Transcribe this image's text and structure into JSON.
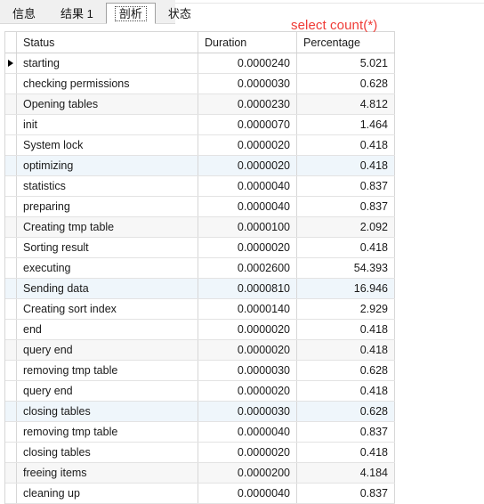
{
  "tabbar": {
    "tabs": [
      {
        "label": "信息",
        "active": false
      },
      {
        "label": "结果 1",
        "active": false
      },
      {
        "label": "剖析",
        "active": true
      },
      {
        "label": "状态",
        "active": false
      }
    ]
  },
  "annotation": {
    "text": "select count(*)",
    "color": "#ef3b36"
  },
  "grid": {
    "columns": [
      "Status",
      "Duration",
      "Percentage"
    ],
    "current_row_index": 0,
    "rows": [
      {
        "status": "starting",
        "duration": "0.0000240",
        "percentage": "5.021",
        "bg": "none"
      },
      {
        "status": "checking permissions",
        "duration": "0.0000030",
        "percentage": "0.628",
        "bg": "none"
      },
      {
        "status": "Opening tables",
        "duration": "0.0000230",
        "percentage": "4.812",
        "bg": "gray"
      },
      {
        "status": "init",
        "duration": "0.0000070",
        "percentage": "1.464",
        "bg": "none"
      },
      {
        "status": "System lock",
        "duration": "0.0000020",
        "percentage": "0.418",
        "bg": "none"
      },
      {
        "status": "optimizing",
        "duration": "0.0000020",
        "percentage": "0.418",
        "bg": "blue"
      },
      {
        "status": "statistics",
        "duration": "0.0000040",
        "percentage": "0.837",
        "bg": "none"
      },
      {
        "status": "preparing",
        "duration": "0.0000040",
        "percentage": "0.837",
        "bg": "none"
      },
      {
        "status": "Creating tmp table",
        "duration": "0.0000100",
        "percentage": "2.092",
        "bg": "gray"
      },
      {
        "status": "Sorting result",
        "duration": "0.0000020",
        "percentage": "0.418",
        "bg": "none"
      },
      {
        "status": "executing",
        "duration": "0.0002600",
        "percentage": "54.393",
        "bg": "none"
      },
      {
        "status": "Sending data",
        "duration": "0.0000810",
        "percentage": "16.946",
        "bg": "blue"
      },
      {
        "status": "Creating sort index",
        "duration": "0.0000140",
        "percentage": "2.929",
        "bg": "none"
      },
      {
        "status": "end",
        "duration": "0.0000020",
        "percentage": "0.418",
        "bg": "none"
      },
      {
        "status": "query end",
        "duration": "0.0000020",
        "percentage": "0.418",
        "bg": "gray"
      },
      {
        "status": "removing tmp table",
        "duration": "0.0000030",
        "percentage": "0.628",
        "bg": "none"
      },
      {
        "status": "query end",
        "duration": "0.0000020",
        "percentage": "0.418",
        "bg": "none"
      },
      {
        "status": "closing tables",
        "duration": "0.0000030",
        "percentage": "0.628",
        "bg": "blue"
      },
      {
        "status": "removing tmp table",
        "duration": "0.0000040",
        "percentage": "0.837",
        "bg": "none"
      },
      {
        "status": "closing tables",
        "duration": "0.0000020",
        "percentage": "0.418",
        "bg": "none"
      },
      {
        "status": "freeing items",
        "duration": "0.0000200",
        "percentage": "4.184",
        "bg": "gray"
      },
      {
        "status": "cleaning up",
        "duration": "0.0000040",
        "percentage": "0.837",
        "bg": "none"
      }
    ]
  }
}
